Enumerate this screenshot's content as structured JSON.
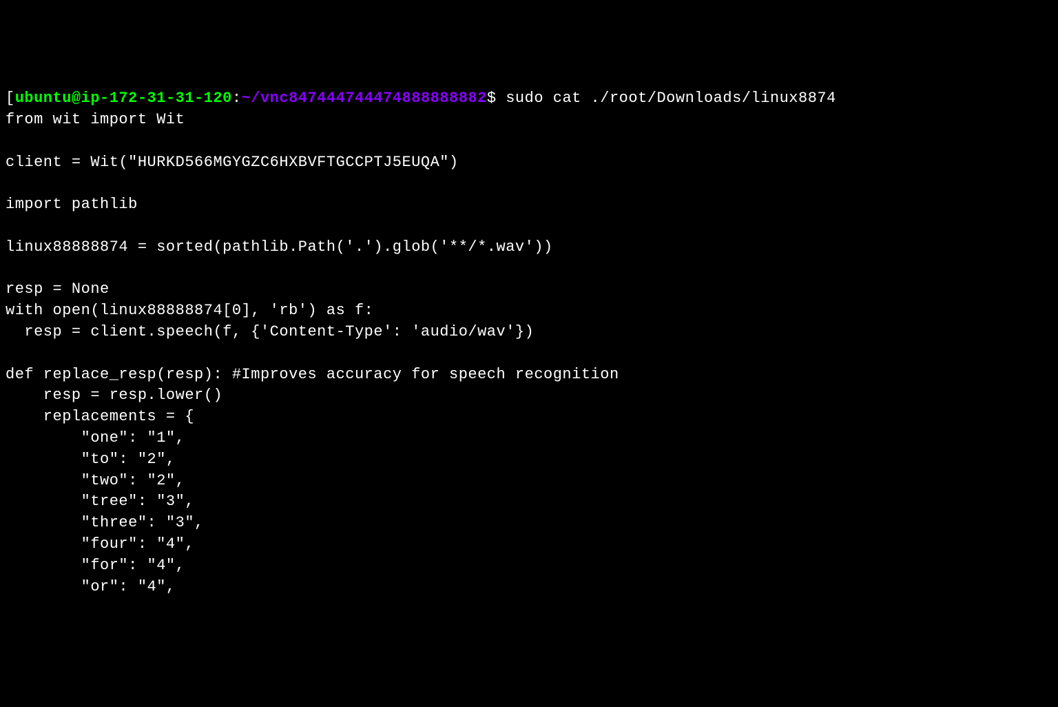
{
  "prompt": {
    "bracket": "[",
    "user": "ubuntu@ip-172-31-31-120",
    "colon": ":",
    "path": "~/vnc847444744474888888882",
    "dollar": "$ "
  },
  "command": "sudo cat ./root/Downloads/linux8874",
  "output_lines": [
    "from wit import Wit",
    "",
    "client = Wit(\"HURKD566MGYGZC6HXBVFTGCCPTJ5EUQA\")",
    "",
    "import pathlib",
    "",
    "linux88888874 = sorted(pathlib.Path('.').glob('**/*.wav'))",
    "",
    "resp = None",
    "with open(linux88888874[0], 'rb') as f:",
    "  resp = client.speech(f, {'Content-Type': 'audio/wav'})",
    "",
    "def replace_resp(resp): #Improves accuracy for speech recognition",
    "    resp = resp.lower()",
    "    replacements = {",
    "        \"one\": \"1\",",
    "        \"to\": \"2\",",
    "        \"two\": \"2\",",
    "        \"tree\": \"3\",",
    "        \"three\": \"3\",",
    "        \"four\": \"4\",",
    "        \"for\": \"4\",",
    "        \"or\": \"4\","
  ]
}
